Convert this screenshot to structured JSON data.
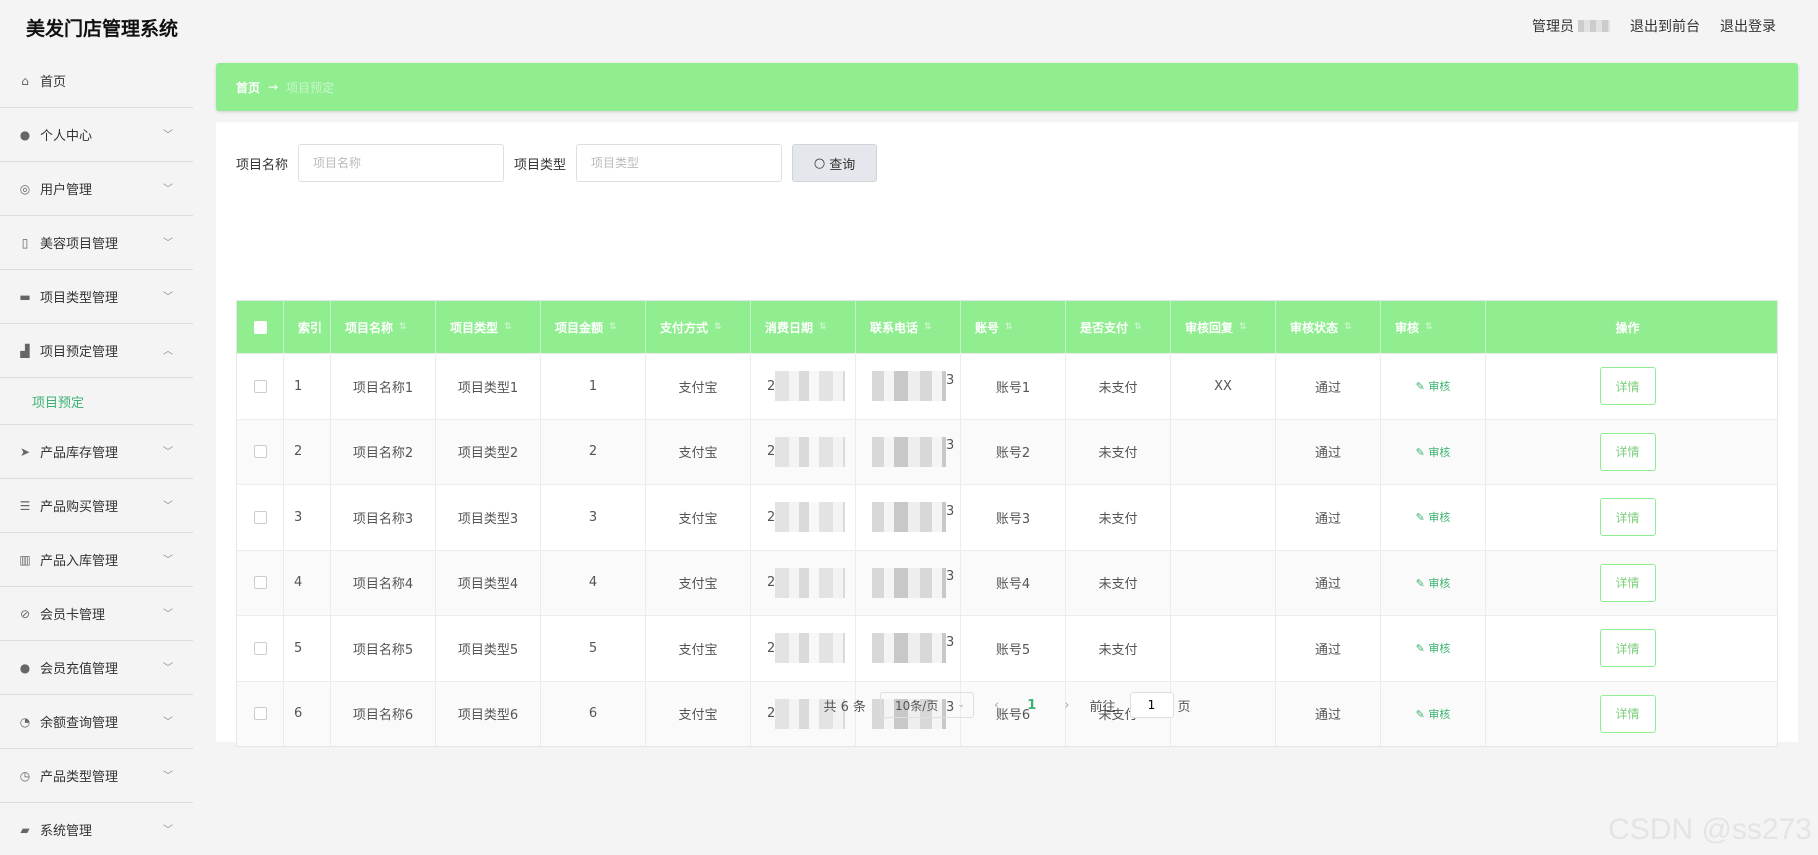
{
  "app": {
    "title": "美发门店管理系统"
  },
  "topbar": {
    "admin_label": "管理员",
    "front_link": "退出到前台",
    "logout_link": "退出登录"
  },
  "sidebar": {
    "items": [
      {
        "label": "首页",
        "icon": "home-icon",
        "glyph": "⌂",
        "expandable": false
      },
      {
        "label": "个人中心",
        "icon": "user-icon",
        "glyph": "●",
        "expandable": true
      },
      {
        "label": "用户管理",
        "icon": "users-icon",
        "glyph": "◎",
        "expandable": true
      },
      {
        "label": "美容项目管理",
        "icon": "beauty-icon",
        "glyph": "▯",
        "expandable": true
      },
      {
        "label": "项目类型管理",
        "icon": "chat-icon",
        "glyph": "▬",
        "expandable": true
      },
      {
        "label": "项目预定管理",
        "icon": "thumb-icon",
        "glyph": "▟",
        "expandable": true,
        "expanded": true
      },
      {
        "label": "产品库存管理",
        "icon": "send-icon",
        "glyph": "➤",
        "expandable": true
      },
      {
        "label": "产品购买管理",
        "icon": "list-icon",
        "glyph": "☰",
        "expandable": true
      },
      {
        "label": "产品入库管理",
        "icon": "chart-icon",
        "glyph": "▥",
        "expandable": true
      },
      {
        "label": "会员卡管理",
        "icon": "compass-icon",
        "glyph": "⊘",
        "expandable": true
      },
      {
        "label": "会员充值管理",
        "icon": "member-icon",
        "glyph": "●",
        "expandable": true
      },
      {
        "label": "余额查询管理",
        "icon": "balance-icon",
        "glyph": "◔",
        "expandable": true
      },
      {
        "label": "产品类型管理",
        "icon": "clock-icon",
        "glyph": "◷",
        "expandable": true
      },
      {
        "label": "系统管理",
        "icon": "system-icon",
        "glyph": "▰",
        "expandable": true
      }
    ],
    "submenu_active": "项目预定"
  },
  "breadcrumb": {
    "home": "首页",
    "separator": "→",
    "current": "项目预定"
  },
  "search": {
    "name_label": "项目名称",
    "name_placeholder": "项目名称",
    "type_label": "项目类型",
    "type_placeholder": "项目类型",
    "button": "查询"
  },
  "table": {
    "columns": [
      "索引",
      "项目名称",
      "项目类型",
      "项目金额",
      "支付方式",
      "消费日期",
      "联系电话",
      "账号",
      "是否支付",
      "审核回复",
      "审核状态",
      "审核",
      "操作"
    ],
    "rows": [
      {
        "index": "1",
        "name": "项目名称1",
        "type": "项目类型1",
        "amount": "1",
        "pay": "支付宝",
        "date": "2",
        "phone": "3",
        "account": "账号1",
        "paid": "未支付",
        "reply": "XX",
        "status": "通过",
        "audit": "审核",
        "action": "详情"
      },
      {
        "index": "2",
        "name": "项目名称2",
        "type": "项目类型2",
        "amount": "2",
        "pay": "支付宝",
        "date": "2",
        "phone": "3",
        "account": "账号2",
        "paid": "未支付",
        "reply": "",
        "status": "通过",
        "audit": "审核",
        "action": "详情"
      },
      {
        "index": "3",
        "name": "项目名称3",
        "type": "项目类型3",
        "amount": "3",
        "pay": "支付宝",
        "date": "2",
        "phone": "3",
        "account": "账号3",
        "paid": "未支付",
        "reply": "",
        "status": "通过",
        "audit": "审核",
        "action": "详情"
      },
      {
        "index": "4",
        "name": "项目名称4",
        "type": "项目类型4",
        "amount": "4",
        "pay": "支付宝",
        "date": "2",
        "phone": "3",
        "account": "账号4",
        "paid": "未支付",
        "reply": "",
        "status": "通过",
        "audit": "审核",
        "action": "详情"
      },
      {
        "index": "5",
        "name": "项目名称5",
        "type": "项目类型5",
        "amount": "5",
        "pay": "支付宝",
        "date": "2",
        "phone": "3",
        "account": "账号5",
        "paid": "未支付",
        "reply": "",
        "status": "通过",
        "audit": "审核",
        "action": "详情"
      },
      {
        "index": "6",
        "name": "项目名称6",
        "type": "项目类型6",
        "amount": "6",
        "pay": "支付宝",
        "date": "2",
        "phone": "3",
        "account": "账号6",
        "paid": "未支付",
        "reply": "",
        "status": "通过",
        "audit": "审核",
        "action": "详情"
      }
    ]
  },
  "pagination": {
    "total": "共 6 条",
    "page_size": "10条/页",
    "current": "1",
    "goto_label": "前往",
    "goto_value": "1",
    "page_suffix": "页"
  },
  "watermark": "CSDN @ss273",
  "colors": {
    "accent": "#90ee90",
    "link": "#3cb371"
  }
}
